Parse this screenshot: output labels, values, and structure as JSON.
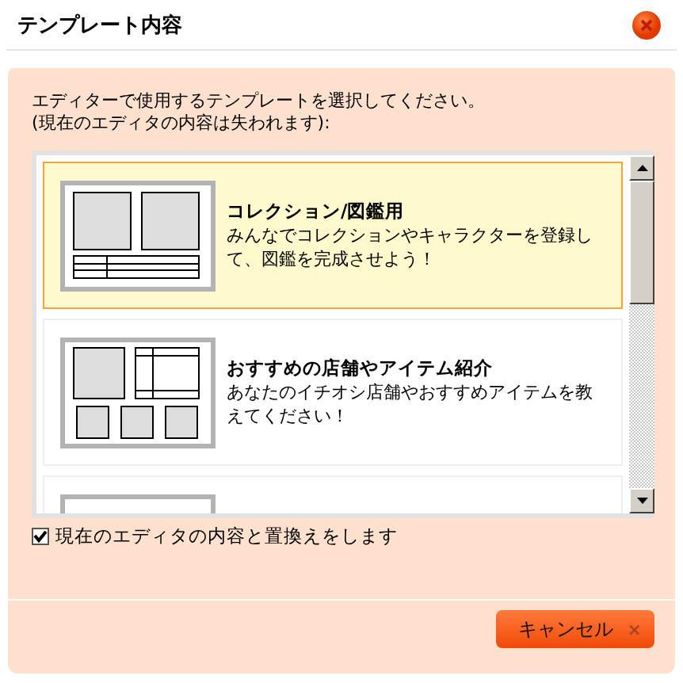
{
  "window": {
    "title": "テンプレート内容"
  },
  "instructions": [
    "エディターで使用するテンプレートを選択してください。",
    "(現在のエディタの内容は失われます):"
  ],
  "templates": [
    {
      "kind": "collection",
      "selected": true,
      "title": "コレクション/図鑑用",
      "description": "みんなでコレクションやキャラクターを登録して、図鑑を完成させよう！"
    },
    {
      "kind": "shop",
      "selected": false,
      "title": "おすすめの店舗やアイテム紹介",
      "description": "あなたのイチオシ店舗やおすすめアイテムを教えてください！"
    },
    {
      "kind": "blank",
      "selected": false
    }
  ],
  "replace_option": {
    "label": "現在のエディタの内容と置換えをします",
    "checked": true
  },
  "buttons": [
    {
      "label": "キャンセル",
      "icon": "×"
    }
  ]
}
